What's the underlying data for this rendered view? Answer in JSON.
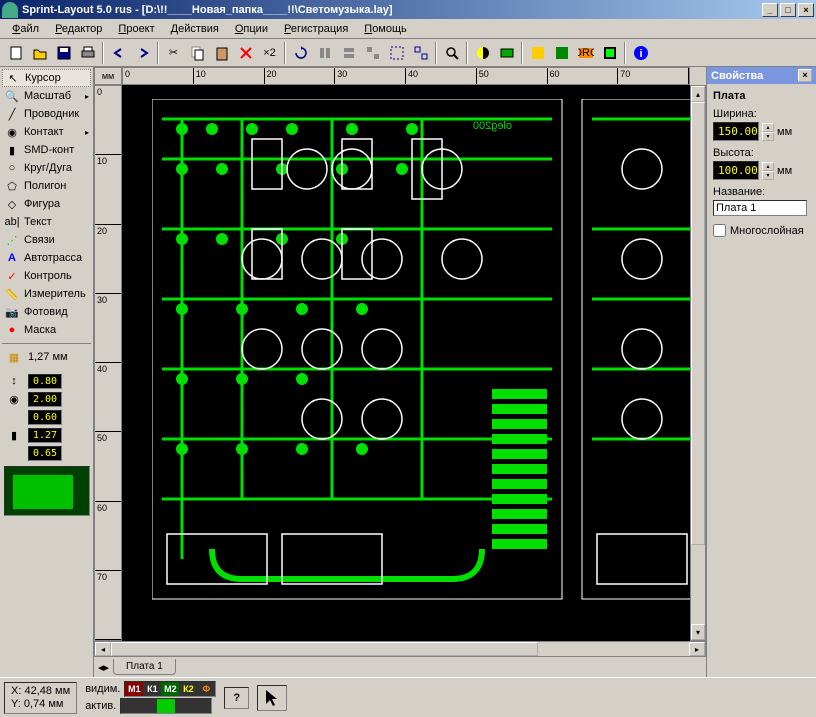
{
  "title": "Sprint-Layout 5.0 rus   - [D:\\!!____Новая_папка____!!\\Светомузыка.lay]",
  "menu": [
    "Файл",
    "Редактор",
    "Проект",
    "Действия",
    "Опции",
    "Регистрация",
    "Помощь"
  ],
  "tools": [
    {
      "label": "Курсор",
      "icon": "cursor",
      "active": true
    },
    {
      "label": "Масштаб",
      "icon": "zoom",
      "arrow": true
    },
    {
      "label": "Проводник",
      "icon": "track"
    },
    {
      "label": "Контакт",
      "icon": "pad",
      "arrow": true
    },
    {
      "label": "SMD-конт",
      "icon": "smd"
    },
    {
      "label": "Круг/Дуга",
      "icon": "circle"
    },
    {
      "label": "Полигон",
      "icon": "polygon"
    },
    {
      "label": "Фигура",
      "icon": "shape"
    },
    {
      "label": "Текст",
      "icon": "text"
    },
    {
      "label": "Связи",
      "icon": "connect"
    },
    {
      "label": "Автотрасса",
      "icon": "autoroute"
    },
    {
      "label": "Контроль",
      "icon": "test"
    },
    {
      "label": "Измеритель",
      "icon": "measure"
    },
    {
      "label": "Фотовид",
      "icon": "photo"
    },
    {
      "label": "Маска",
      "icon": "mask"
    }
  ],
  "grid_label": "1,27 мм",
  "params": [
    "0.80",
    "2.00",
    "0.60",
    "1.27",
    "0.65"
  ],
  "ruler_unit": "мм",
  "ruler_h": [
    "0",
    "10",
    "20",
    "30",
    "40",
    "50",
    "60",
    "70"
  ],
  "ruler_v": [
    "0",
    "10",
    "20",
    "30",
    "40",
    "50",
    "60",
    "70"
  ],
  "tab_name": "Плата 1",
  "props": {
    "title": "Свойства",
    "section": "Плата",
    "width_lbl": "Ширина:",
    "width_val": "150.00",
    "height_lbl": "Высота:",
    "height_val": "100.00",
    "unit": "мм",
    "name_lbl": "Название:",
    "name_val": "Плата 1",
    "multi_lbl": "Многослойная"
  },
  "status": {
    "x_lbl": "X:",
    "x_val": "42,48 мм",
    "y_lbl": "Y:",
    "y_val": "0,74 мм",
    "vis": "видим.",
    "act": "актив.",
    "layers": [
      {
        "t": "М1",
        "c": "#ff0000"
      },
      {
        "t": "К1",
        "c": "#ffffff"
      },
      {
        "t": "М2",
        "c": "#00ff00"
      },
      {
        "t": "К2",
        "c": "#ffff00"
      },
      {
        "t": "Ф",
        "c": "#ff8800"
      }
    ],
    "help": "?"
  },
  "pcb_text": "oleg200"
}
